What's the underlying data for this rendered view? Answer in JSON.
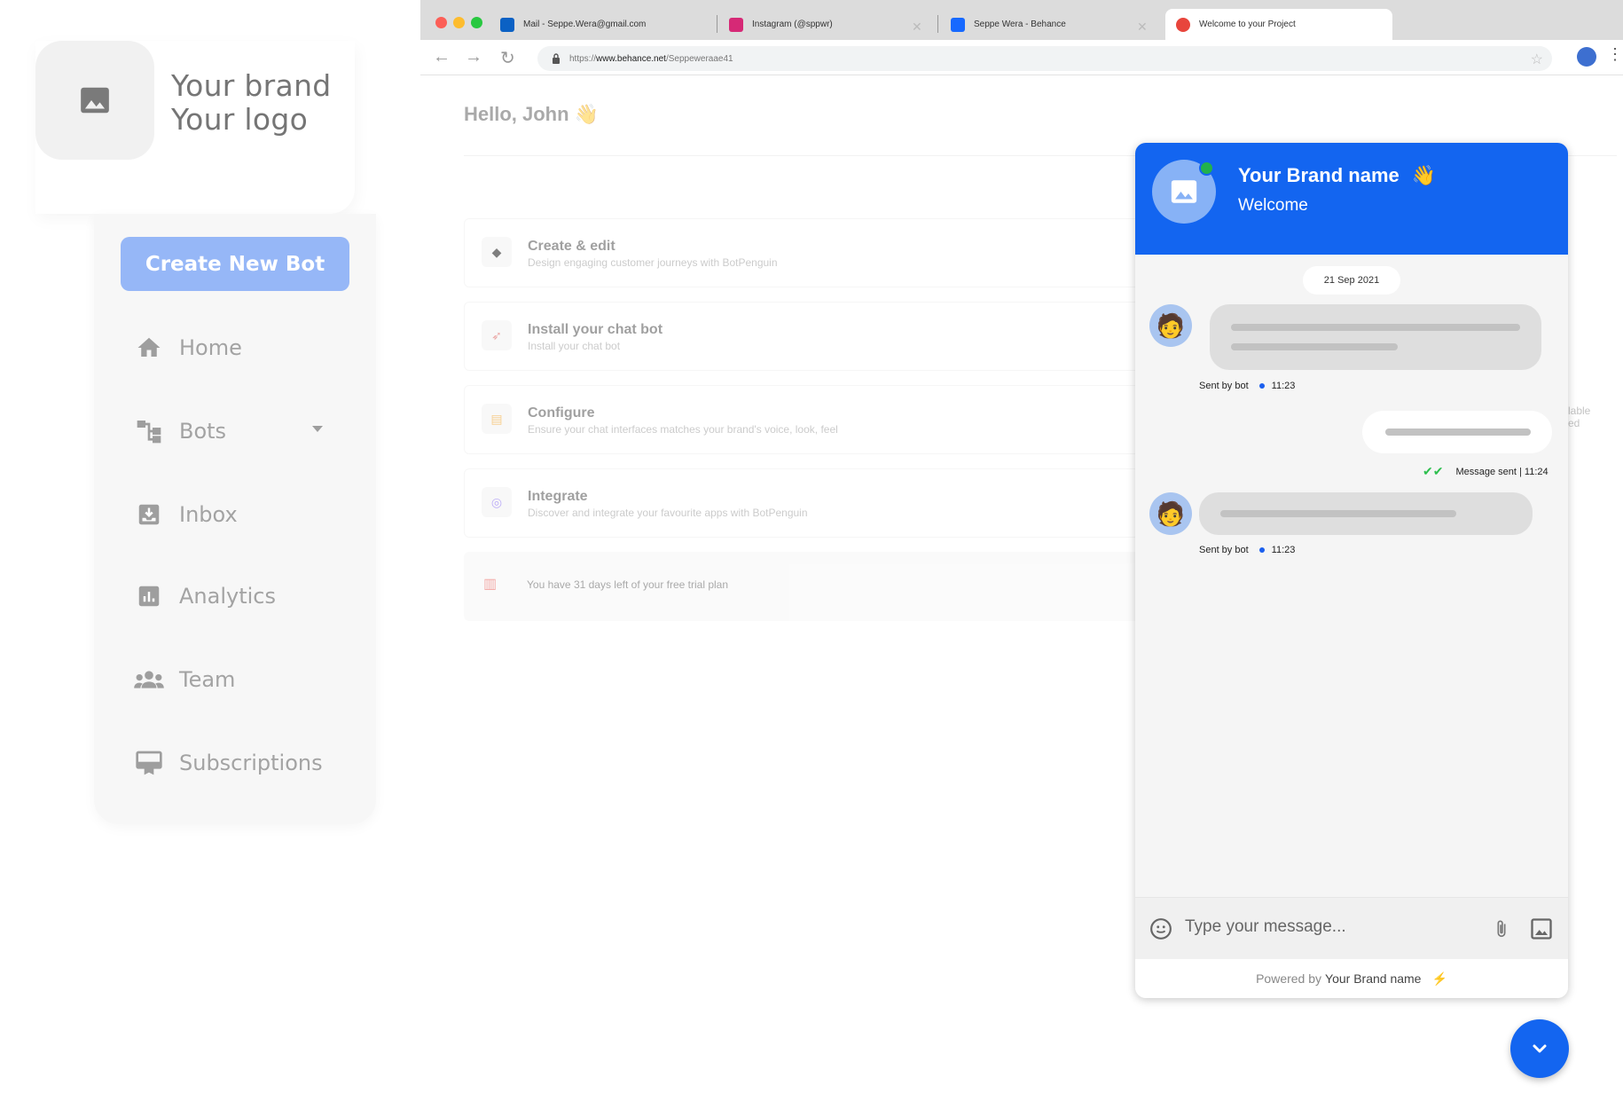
{
  "brand": {
    "line1": "Your brand",
    "line2": "Your logo"
  },
  "sidebar": {
    "create_label": "Create New Bot",
    "items": [
      {
        "label": "Home",
        "icon": "home-icon"
      },
      {
        "label": "Bots",
        "icon": "bots-icon"
      },
      {
        "label": "Inbox",
        "icon": "inbox-icon"
      },
      {
        "label": "Analytics",
        "icon": "analytics-icon"
      },
      {
        "label": "Team",
        "icon": "team-icon"
      },
      {
        "label": "Subscriptions",
        "icon": "subscriptions-icon"
      }
    ]
  },
  "browser": {
    "tabs": [
      {
        "title": "Mail - Seppe.Wera@gmail.com",
        "color": "#0b61c4"
      },
      {
        "title": "Instagram (@sppwr)",
        "color": "#d62976"
      },
      {
        "title": "Seppe Wera - Behance",
        "color": "#1769ff"
      },
      {
        "title": "Welcome to your Project",
        "color": "#e8453c"
      }
    ],
    "url_prefix": "https://",
    "url_host": "www.behance.net",
    "url_path": "/Seppeweraae41"
  },
  "page": {
    "greeting": "Hello, John",
    "greeting_emoji": "👋",
    "steps": [
      {
        "title": "Create & edit",
        "desc": "Design engaging customer journeys with BotPenguin"
      },
      {
        "title": "Install your chat bot",
        "desc": "Install your chat bot"
      },
      {
        "title": "Configure",
        "desc": "Ensure your chat interfaces matches your brand's voice, look, feel"
      },
      {
        "title": "Integrate",
        "desc": "Discover and integrate your favourite apps with BotPenguin"
      }
    ],
    "trial_text": "You have 31 days left of your free trial plan",
    "side_note_1": "lable",
    "side_note_2": "ed"
  },
  "chat": {
    "brand_name": "Your Brand name",
    "wave": "👋",
    "welcome": "Welcome",
    "date": "21 Sep 2021",
    "sent_by": "Sent by bot",
    "time_1": "11:23",
    "sent_status": "Message sent | 11:24",
    "time_2": "11:23",
    "input_placeholder": "Type your message...",
    "powered_by": "Powered by",
    "powered_brand": "Your Brand name",
    "accent_color": "#1365f0"
  }
}
